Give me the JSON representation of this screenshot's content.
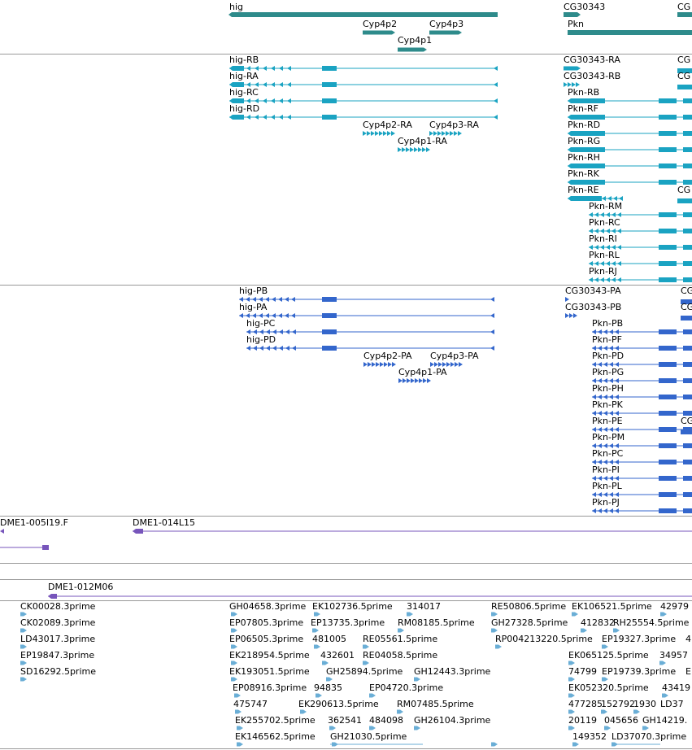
{
  "colors": {
    "gene": "#2e8b8b",
    "transcript": "#1aa3c2",
    "protein": "#3366cc",
    "clone": "#7755bb",
    "est": "#6aaed6",
    "separator": "#999999"
  },
  "tracks": {
    "genes": [
      "hig",
      "Cyp4p2",
      "Cyp4p3",
      "Cyp4p1",
      "CG30343",
      "Pkn",
      "CG"
    ],
    "transcripts": [
      "hig-RB",
      "hig-RA",
      "hig-RC",
      "hig-RD",
      "Cyp4p2-RA",
      "Cyp4p3-RA",
      "Cyp4p1-RA",
      "CG30343-RA",
      "CG30343-RB",
      "Pkn-RB",
      "Pkn-RF",
      "Pkn-RD",
      "Pkn-RG",
      "Pkn-RH",
      "Pkn-RK",
      "Pkn-RE",
      "Pkn-RM",
      "Pkn-RC",
      "Pkn-RI",
      "Pkn-RL",
      "Pkn-RJ",
      "CG",
      "CG",
      "CG"
    ],
    "proteins": [
      "hig-PB",
      "hig-PA",
      "hig-PC",
      "hig-PD",
      "Cyp4p2-PA",
      "Cyp4p3-PA",
      "Cyp4p1-PA",
      "CG30343-PA",
      "CG30343-PB",
      "Pkn-PB",
      "Pkn-PF",
      "Pkn-PD",
      "Pkn-PG",
      "Pkn-PH",
      "Pkn-PK",
      "Pkn-PE",
      "Pkn-PM",
      "Pkn-PC",
      "Pkn-PI",
      "Pkn-PL",
      "Pkn-PJ",
      "CG",
      "CG",
      "CG"
    ],
    "clones": [
      "DME1-005I19.F",
      "DME1-014L15",
      "DME1-012M06"
    ],
    "ests": [
      "CK00028.3prime",
      "CK02089.3prime",
      "LD43017.3prime",
      "EP19847.3prime",
      "SD16292.5prime",
      "GH04658.3prime",
      "EK102736.5prime",
      "314017",
      "RE50806.5prime",
      "EK106521.5prime",
      "42979",
      "EP07805.3prime",
      "EP13735.3prime",
      "RM08185.5prime",
      "GH27328.5prime",
      "412832",
      "RH25554.5prime",
      "EP06505.3prime",
      "481005",
      "RE05561.5prime",
      "RP004213220.5prime",
      "EP19327.3prime",
      "4",
      "EK218954.5prime",
      "432601",
      "RE04058.5prime",
      "EK065125.5prime",
      "34957",
      "EK193051.5prime",
      "GH25894.5prime",
      "GH12443.3prime",
      "74799",
      "EP19739.3prime",
      "E",
      "EP08916.3prime",
      "94835",
      "EP04720.3prime",
      "EK052320.5prime",
      "43419",
      "475747",
      "EK290613.5prime",
      "RM07485.5prime",
      "477285",
      "152792",
      "1930",
      "LD37",
      "EK255702.5prime",
      "362541",
      "484098",
      "GH26104.3prime",
      "20119",
      "045656",
      "GH14219.",
      "EK146562.5prime",
      "GH21030.5prime",
      "149352",
      "LD37070.3prime"
    ]
  }
}
